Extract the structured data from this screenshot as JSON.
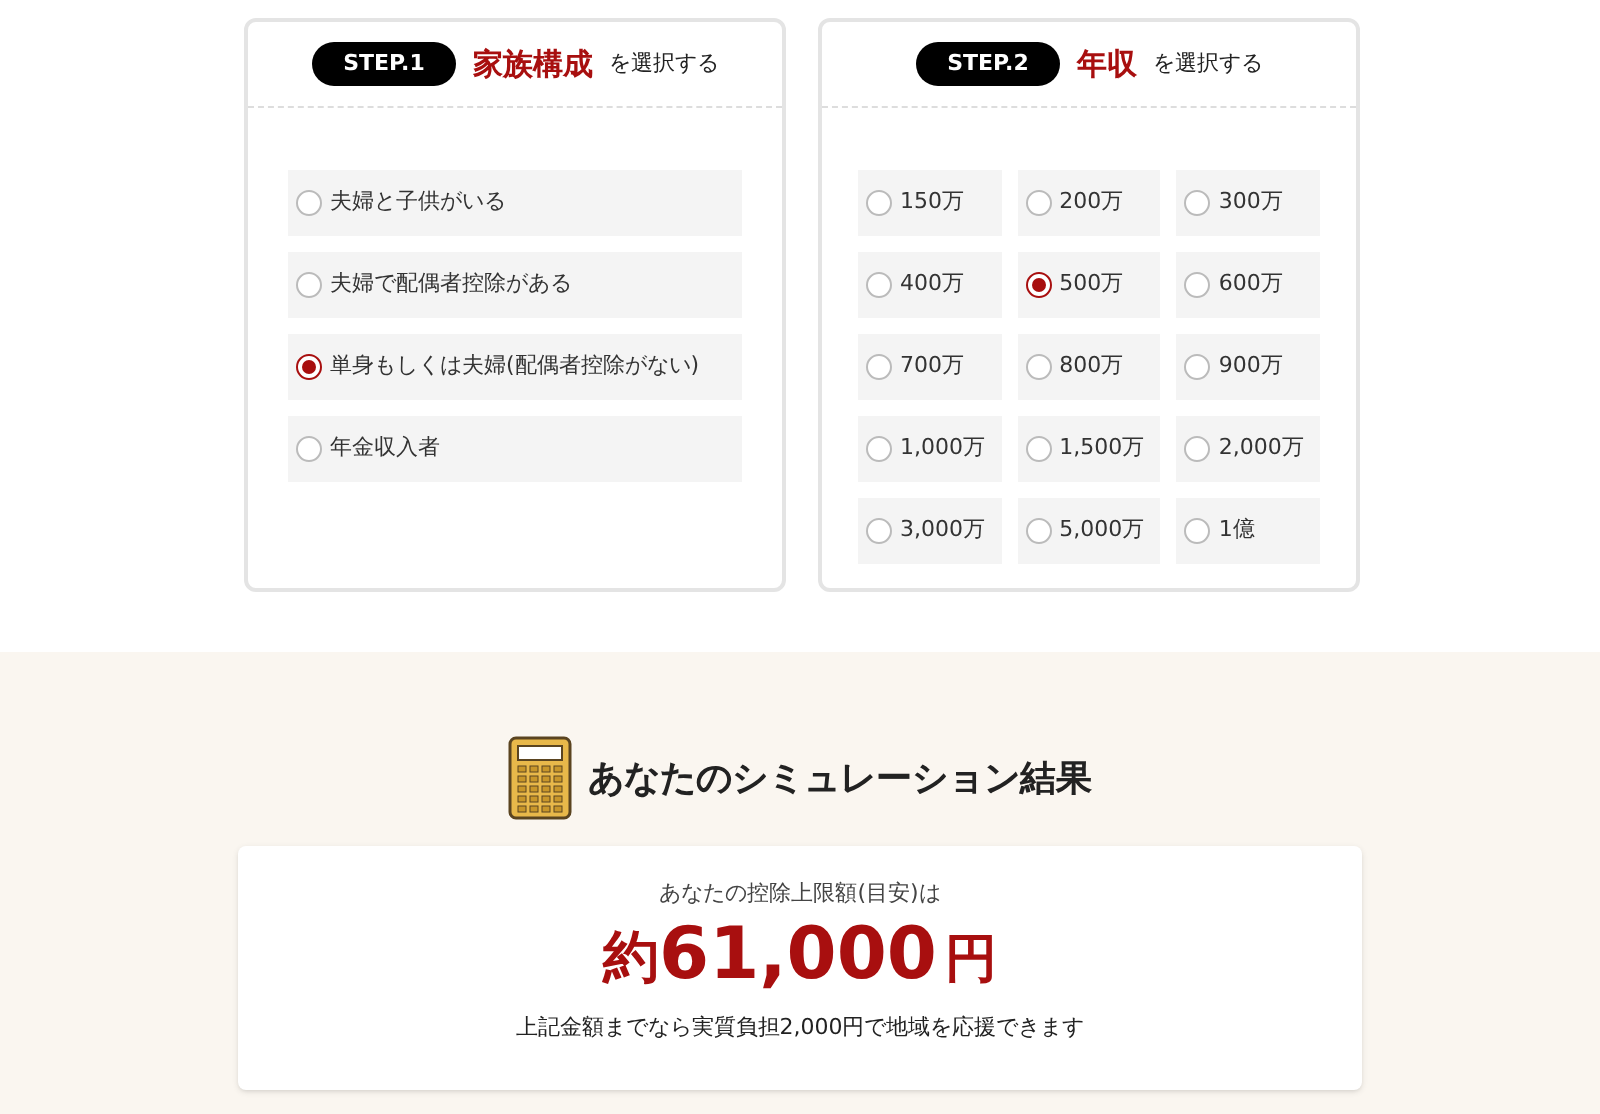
{
  "steps": [
    {
      "badge": "STEP.1",
      "title": "家族構成",
      "suffix": "を選択する",
      "kind": "list",
      "options": [
        {
          "label": "夫婦と子供がいる",
          "selected": false
        },
        {
          "label": "夫婦で配偶者控除がある",
          "selected": false
        },
        {
          "label": "単身もしくは夫婦(配偶者控除がない)",
          "selected": true
        },
        {
          "label": "年金収入者",
          "selected": false
        }
      ]
    },
    {
      "badge": "STEP.2",
      "title": "年収",
      "suffix": "を選択する",
      "kind": "grid",
      "options": [
        {
          "label": "150万",
          "selected": false
        },
        {
          "label": "200万",
          "selected": false
        },
        {
          "label": "300万",
          "selected": false
        },
        {
          "label": "400万",
          "selected": false
        },
        {
          "label": "500万",
          "selected": true
        },
        {
          "label": "600万",
          "selected": false
        },
        {
          "label": "700万",
          "selected": false
        },
        {
          "label": "800万",
          "selected": false
        },
        {
          "label": "900万",
          "selected": false
        },
        {
          "label": "1,000万",
          "selected": false
        },
        {
          "label": "1,500万",
          "selected": false
        },
        {
          "label": "2,000万",
          "selected": false
        },
        {
          "label": "3,000万",
          "selected": false
        },
        {
          "label": "5,000万",
          "selected": false
        },
        {
          "label": "1億",
          "selected": false
        }
      ]
    }
  ],
  "result": {
    "heading": "あなたのシミュレーション結果",
    "caption": "あなたの控除上限額(目安)は",
    "prefix": "約",
    "amount": "61,000",
    "unit": "円",
    "note": "上記金額までなら実質負担2,000円で地域を応援できます"
  }
}
